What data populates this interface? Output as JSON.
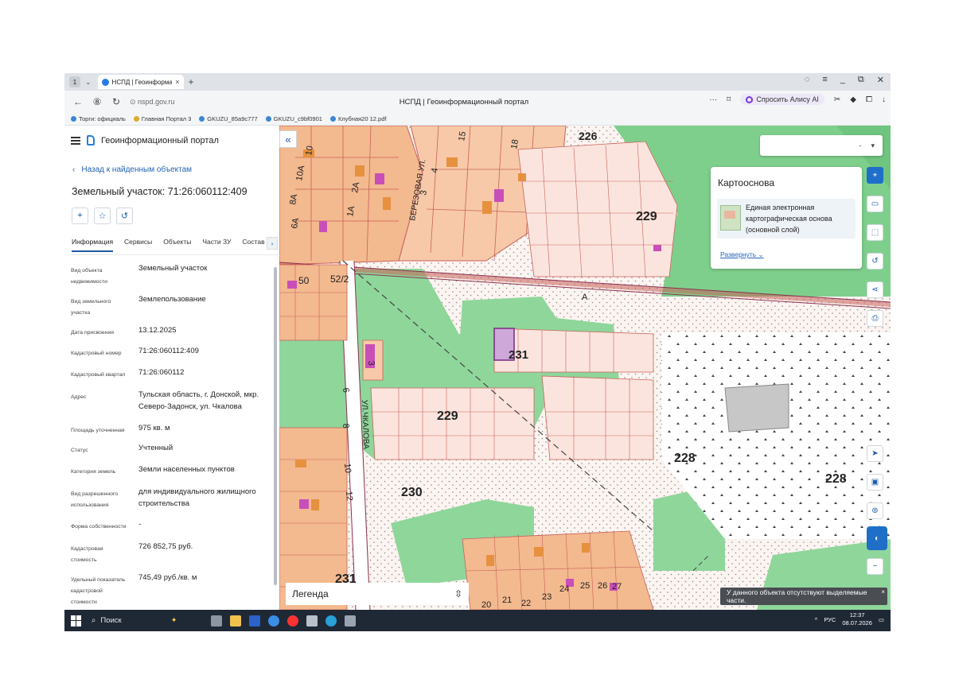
{
  "browser": {
    "tab_count": "1",
    "tab_title": "НСПД | Геоинформацио",
    "url": "nspd.gov.ru",
    "page_title": "НСПД | Геоинформационный портал",
    "alice_label": "Спросить Алису AI",
    "bookmarks": [
      "Торги: официаль",
      "Главная Портал 3",
      "GKUZU_85a9c777",
      "GKUZU_c9bf0901",
      "Клубная20 12.pdf"
    ]
  },
  "panel": {
    "portal_name": "Геоинформационный портал",
    "back_label": "Назад к найденным объектам",
    "object_title": "Земельный участок: 71:26:060112:409",
    "tabs": [
      "Информация",
      "Сервисы",
      "Объекты",
      "Части ЗУ",
      "Состав"
    ],
    "properties": [
      {
        "k": "Вид объекта недвижимости",
        "v": "Земельный участок"
      },
      {
        "k": "Вид земельного участка",
        "v": "Землепользование"
      },
      {
        "k": "Дата присвоения",
        "v": "13.12.2025"
      },
      {
        "k": "Кадастровый номер",
        "v": "71:26:060112:409"
      },
      {
        "k": "Кадастровый квартал",
        "v": "71:26:060112"
      },
      {
        "k": "Адрес",
        "v": "Тульская область, г. Донской, мкр. Северо-Задонск, ул. Чкалова"
      },
      {
        "k": "Площадь уточненная",
        "v": "975 кв. м"
      },
      {
        "k": "Статус",
        "v": "Учтенный"
      },
      {
        "k": "Категория земель",
        "v": "Земли населенных пунктов"
      },
      {
        "k": "Вид разрешенного использования",
        "v": "для индивидуального жилищного строительства"
      },
      {
        "k": "Форма собственности",
        "v": "-"
      },
      {
        "k": "Кадастровая стоимость",
        "v": "726 852,75 руб."
      },
      {
        "k": "Удельный показатель кадастровой стоимости",
        "v": "745,49 руб./кв. м"
      }
    ]
  },
  "map": {
    "basemap_title": "Картооснова",
    "basemap_item": "Единая электронная картографическая основа (основной слой)",
    "expand_label": "Развернуть",
    "select_value": "-",
    "legend_label": "Легенда",
    "toast": "У данного объекта отсутствуют выделяемые части.",
    "labels": {
      "a": "226",
      "b": "229",
      "c": "229",
      "d": "231",
      "e": "230",
      "f": "228",
      "g": "228",
      "h": "231",
      "i": "52/2",
      "j": "50",
      "k": "А",
      "street1": "БЕРЕЗОВАЯ УЛ.",
      "street2": "УЛ.ЧКАЛОВА",
      "n1": "20",
      "n2": "21",
      "n3": "22",
      "n4": "23",
      "n5": "24",
      "n6": "25",
      "n7": "26",
      "n8": "27",
      "h1": "10",
      "h2": "10А",
      "h3": "8А",
      "h4": "6А",
      "h5": "2А",
      "h6": "1А",
      "h7": "3",
      "h8": "4",
      "h9": "15",
      "h10": "18",
      "h11": "6",
      "h12": "8",
      "h13": "10",
      "h14": "12",
      "h15": "3"
    }
  },
  "taskbar": {
    "search": "Поиск",
    "lang": "РУС",
    "time": "12:37",
    "date": "08.07.2026"
  }
}
